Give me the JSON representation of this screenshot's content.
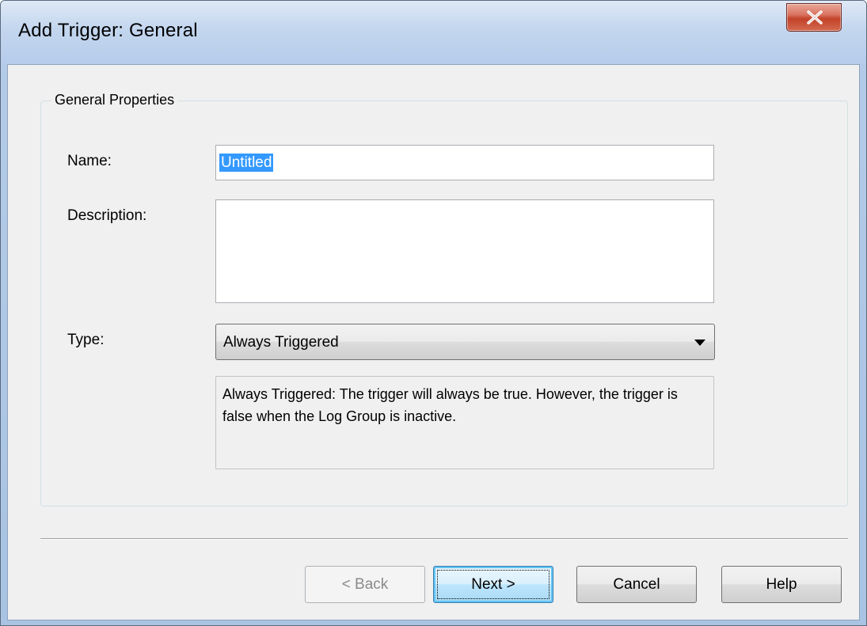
{
  "window": {
    "title": "Add Trigger: General"
  },
  "group": {
    "legend": "General Properties"
  },
  "fields": {
    "name_label": "Name:",
    "name_value": "Untitled",
    "description_label": "Description:",
    "description_value": "",
    "type_label": "Type:",
    "type_value": "Always Triggered",
    "type_description": "Always Triggered: The trigger will always be true. However, the trigger is false when the Log Group is inactive."
  },
  "buttons": {
    "back": "< Back",
    "next": "Next >",
    "cancel": "Cancel",
    "help": "Help"
  },
  "icons": {
    "close": "close-icon",
    "dropdown": "dropdown-arrow-icon"
  },
  "colors": {
    "selection": "#3399ff",
    "close_button": "#c2432a",
    "default_button_border": "#3c7fb1"
  }
}
